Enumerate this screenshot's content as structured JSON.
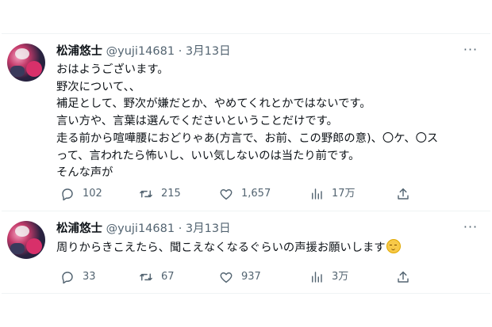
{
  "tweets": [
    {
      "author": {
        "name": "松浦悠士",
        "handle": "@yuji14681",
        "separator": "·",
        "date": "3月13日"
      },
      "more_label": "···",
      "lines": [
        "おはようございます。",
        "野次について、、",
        "補足として、野次が嫌だとか、やめてくれとかではないです。",
        "言い方や、言葉は選んでくださいということだけです。",
        "走る前から喧嘩腰におどりゃあ(方言で、お前、この野郎の意)、〇ケ、〇ス",
        "って、言われたら怖いし、いい気しないのは当たり前です。",
        "そんな声が"
      ],
      "actions": {
        "replies": "102",
        "retweets": "215",
        "likes": "1,657",
        "views": "17万"
      }
    },
    {
      "author": {
        "name": "松浦悠士",
        "handle": "@yuji14681",
        "separator": "·",
        "date": "3月13日"
      },
      "more_label": "···",
      "lines": [
        "周りからきこえたら、聞こえなくなるぐらいの声援お願いします"
      ],
      "emoji": "relieved-face-emoji",
      "actions": {
        "replies": "33",
        "retweets": "67",
        "likes": "937",
        "views": "3万"
      }
    }
  ],
  "icons": {
    "reply": "reply-icon",
    "retweet": "retweet-icon",
    "like": "heart-icon",
    "views": "views-icon",
    "share": "share-icon",
    "more": "more-icon"
  },
  "colors": {
    "text": "#0f1419",
    "secondary": "#536471",
    "divider": "#eff3f4"
  }
}
